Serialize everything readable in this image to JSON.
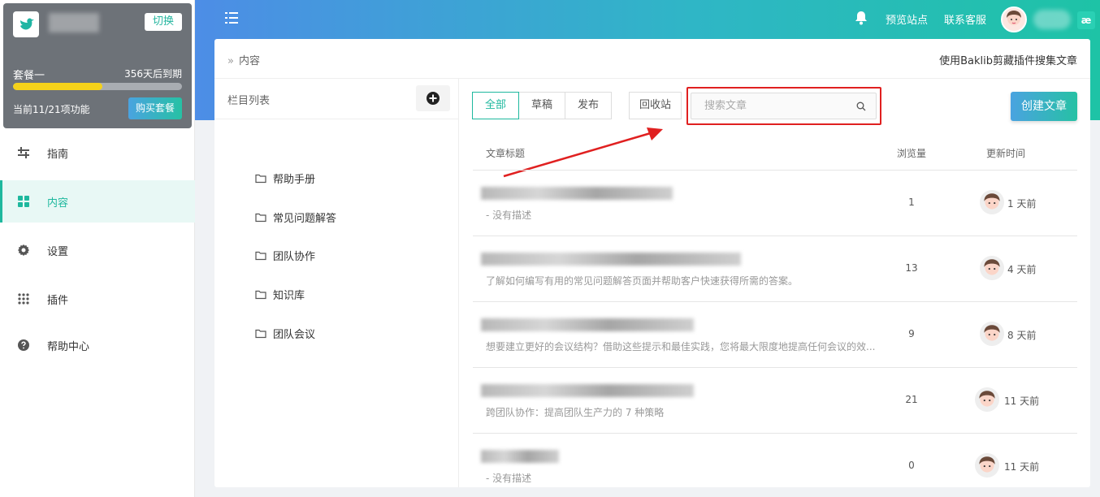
{
  "header": {
    "preview_site": "预览站点",
    "contact_support": "联系客服",
    "brand_glyph": "æ"
  },
  "plan": {
    "switch_label": "切换",
    "package_label": "套餐一",
    "expire_text": "356天后到期",
    "usage_progress_fraction": 0.53,
    "usage_text": "当前11/21项功能",
    "buy_label": "购买套餐"
  },
  "sidebar": {
    "items": [
      {
        "label": "指南",
        "icon": "guide-icon"
      },
      {
        "label": "内容",
        "icon": "grid-icon"
      },
      {
        "label": "设置",
        "icon": "gear-icon"
      },
      {
        "label": "插件",
        "icon": "dots-grid-icon"
      },
      {
        "label": "帮助中心",
        "icon": "help-icon"
      }
    ]
  },
  "breadcrumb": {
    "current": "内容"
  },
  "clipper_link": "使用Baklib剪藏插件搜集文章",
  "columns": {
    "title": "栏目列表",
    "items": [
      "帮助手册",
      "常见问题解答",
      "团队协作",
      "知识库",
      "团队会议"
    ]
  },
  "tabs": [
    "全部",
    "草稿",
    "发布"
  ],
  "recycle_label": "回收站",
  "search": {
    "placeholder": "搜索文章"
  },
  "create_label": "创建文章",
  "table": {
    "headers": {
      "title": "文章标题",
      "views": "浏览量",
      "updated": "更新时间"
    },
    "rows": [
      {
        "desc": "- 没有描述",
        "views": "1",
        "updated": "1 天前"
      },
      {
        "desc": "了解如何编写有用的常见问题解答页面并帮助客户快速获得所需的答案。",
        "views": "13",
        "updated": "4 天前"
      },
      {
        "desc": "想要建立更好的会议结构？借助这些提示和最佳实践，您将最大限度地提高任何会议的效...",
        "views": "9",
        "updated": "8 天前"
      },
      {
        "desc": "跨团队协作：提高团队生产力的 7 种策略",
        "views": "21",
        "updated": "11 天前"
      },
      {
        "desc": "- 没有描述",
        "views": "0",
        "updated": "11 天前"
      }
    ]
  },
  "colors": {
    "accent": "#1eb89e",
    "highlight": "#e02020",
    "progress": "#f5d21a"
  }
}
